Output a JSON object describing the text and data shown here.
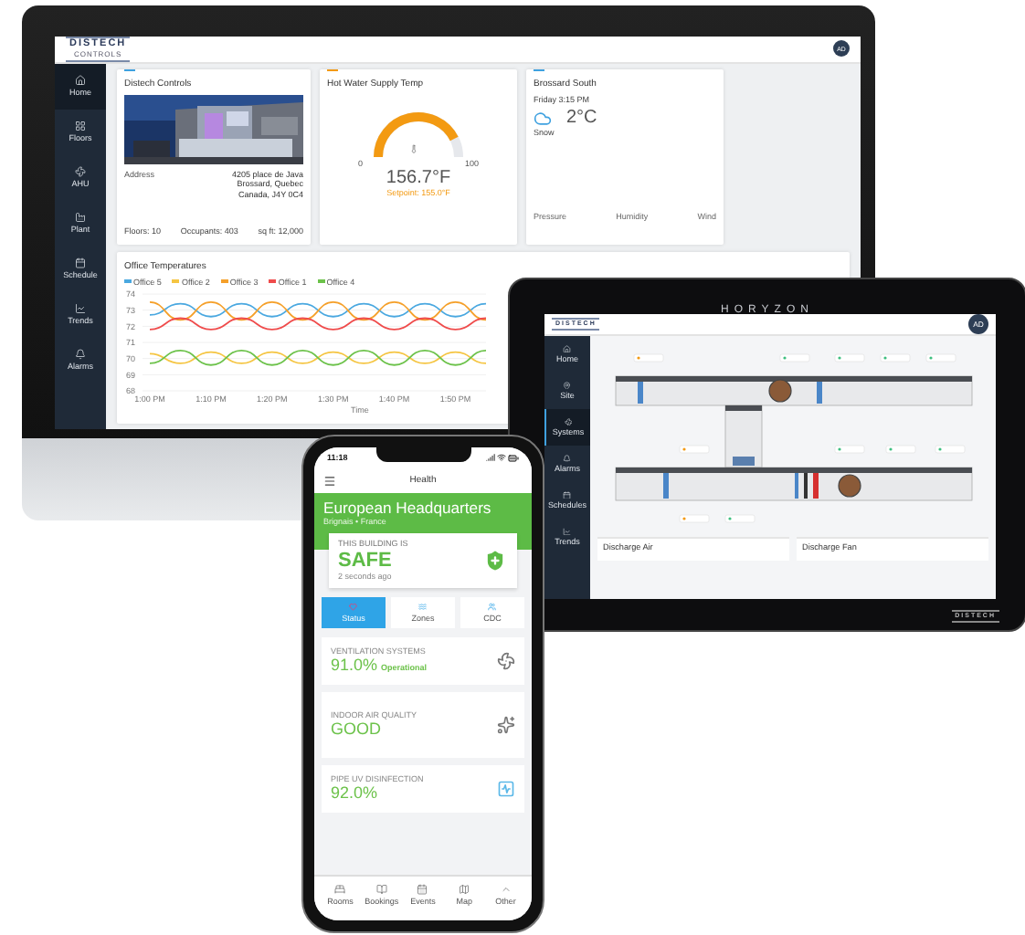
{
  "monitor": {
    "logo": "DISTECH",
    "logo_sub": "CONTROLS",
    "avatar": "AD",
    "sidebar": [
      {
        "label": "Home",
        "selected": true
      },
      {
        "label": "Floors",
        "selected": false
      },
      {
        "label": "AHU",
        "selected": false
      },
      {
        "label": "Plant",
        "selected": false
      },
      {
        "label": "Schedule",
        "selected": false
      },
      {
        "label": "Trends",
        "selected": false
      },
      {
        "label": "Alarms",
        "selected": false
      }
    ],
    "building_card": {
      "title": "Distech Controls",
      "address_label": "Address",
      "address_lines": [
        "4205 place de Java",
        "Brossard, Quebec",
        "Canada, J4Y 0C4"
      ],
      "stats": [
        "Floors: 10",
        "Occupants: 403",
        "sq ft: 12,000"
      ]
    },
    "gauge_card": {
      "title": "Hot Water Supply Temp",
      "min": "0",
      "max": "100",
      "value": "156.7°F",
      "setpoint": "Setpoint: 155.0°F"
    },
    "weather_card": {
      "title": "Brossard South",
      "time": "Friday 3:15 PM",
      "temperature": "2°C",
      "condition": "Snow",
      "stats": [
        "Pressure",
        "Humidity",
        "Wind"
      ]
    },
    "chart_card": {
      "title": "Office Temperatures",
      "chart_data": {
        "type": "line",
        "xlabel": "Time",
        "grid": true,
        "legend": true,
        "categories": [
          "1:00 PM",
          null,
          "1:10 PM",
          null,
          "1:20 PM",
          null,
          "1:30 PM",
          null,
          "1:40 PM",
          null,
          "1:50 PM",
          null
        ],
        "ylim": [
          68,
          74
        ],
        "yticks": [
          68,
          69,
          70,
          71,
          72,
          73,
          74
        ],
        "series": [
          {
            "name": "Office 5",
            "color": "#4aa8e0",
            "values": [
              72.7,
              73.4,
              72.6,
              73.4,
              72.6,
              73.4,
              72.6,
              73.4,
              72.6,
              73.4,
              72.6,
              73.4
            ]
          },
          {
            "name": "Office 2",
            "color": "#f5c542",
            "values": [
              70.3,
              69.7,
              70.4,
              69.7,
              70.4,
              69.7,
              70.4,
              69.7,
              70.4,
              69.7,
              70.4,
              69.7
            ]
          },
          {
            "name": "Office 3",
            "color": "#f5a02a",
            "values": [
              73.5,
              72.4,
              73.5,
              72.4,
              73.5,
              72.4,
              73.5,
              72.4,
              73.5,
              72.4,
              73.5,
              72.4
            ]
          },
          {
            "name": "Office 1",
            "color": "#ef4b4b",
            "values": [
              71.8,
              72.5,
              71.8,
              72.5,
              71.8,
              72.5,
              71.8,
              72.5,
              71.8,
              72.5,
              71.8,
              72.5
            ]
          },
          {
            "name": "Office 4",
            "color": "#6cc24a",
            "values": [
              69.7,
              70.5,
              69.6,
              70.5,
              69.6,
              70.5,
              69.6,
              70.5,
              69.6,
              70.5,
              69.6,
              70.5
            ]
          }
        ]
      }
    }
  },
  "tablet": {
    "brand": "HORYZON",
    "bezel_logo": "DISTECH",
    "logo": "DISTECH",
    "avatar": "AD",
    "sidebar": [
      {
        "label": "Home",
        "selected": false
      },
      {
        "label": "Site",
        "selected": false
      },
      {
        "label": "Systems",
        "selected": true
      },
      {
        "label": "Alarms",
        "selected": false
      },
      {
        "label": "Schedules",
        "selected": false
      },
      {
        "label": "Trends",
        "selected": false
      }
    ],
    "panels": [
      "Discharge Air",
      "Discharge Fan"
    ]
  },
  "phone": {
    "time": "11:18",
    "title": "Health",
    "building": "European Headquarters",
    "location": "Brignais • France",
    "status_card": {
      "caption": "THIS BUILDING IS",
      "status": "SAFE",
      "updated": "2 seconds ago"
    },
    "tabs": [
      {
        "label": "Status",
        "selected": true
      },
      {
        "label": "Zones",
        "selected": false
      },
      {
        "label": "CDC",
        "selected": false
      }
    ],
    "cards": [
      {
        "title": "VENTILATION SYSTEMS",
        "value": "91.0%",
        "note": "Operational"
      },
      {
        "title": "INDOOR AIR QUALITY",
        "value": "GOOD"
      },
      {
        "title": "PIPE UV DISINFECTION",
        "value": "92.0%"
      }
    ],
    "nav": [
      "Rooms",
      "Bookings",
      "Events",
      "Map",
      "Other"
    ]
  }
}
